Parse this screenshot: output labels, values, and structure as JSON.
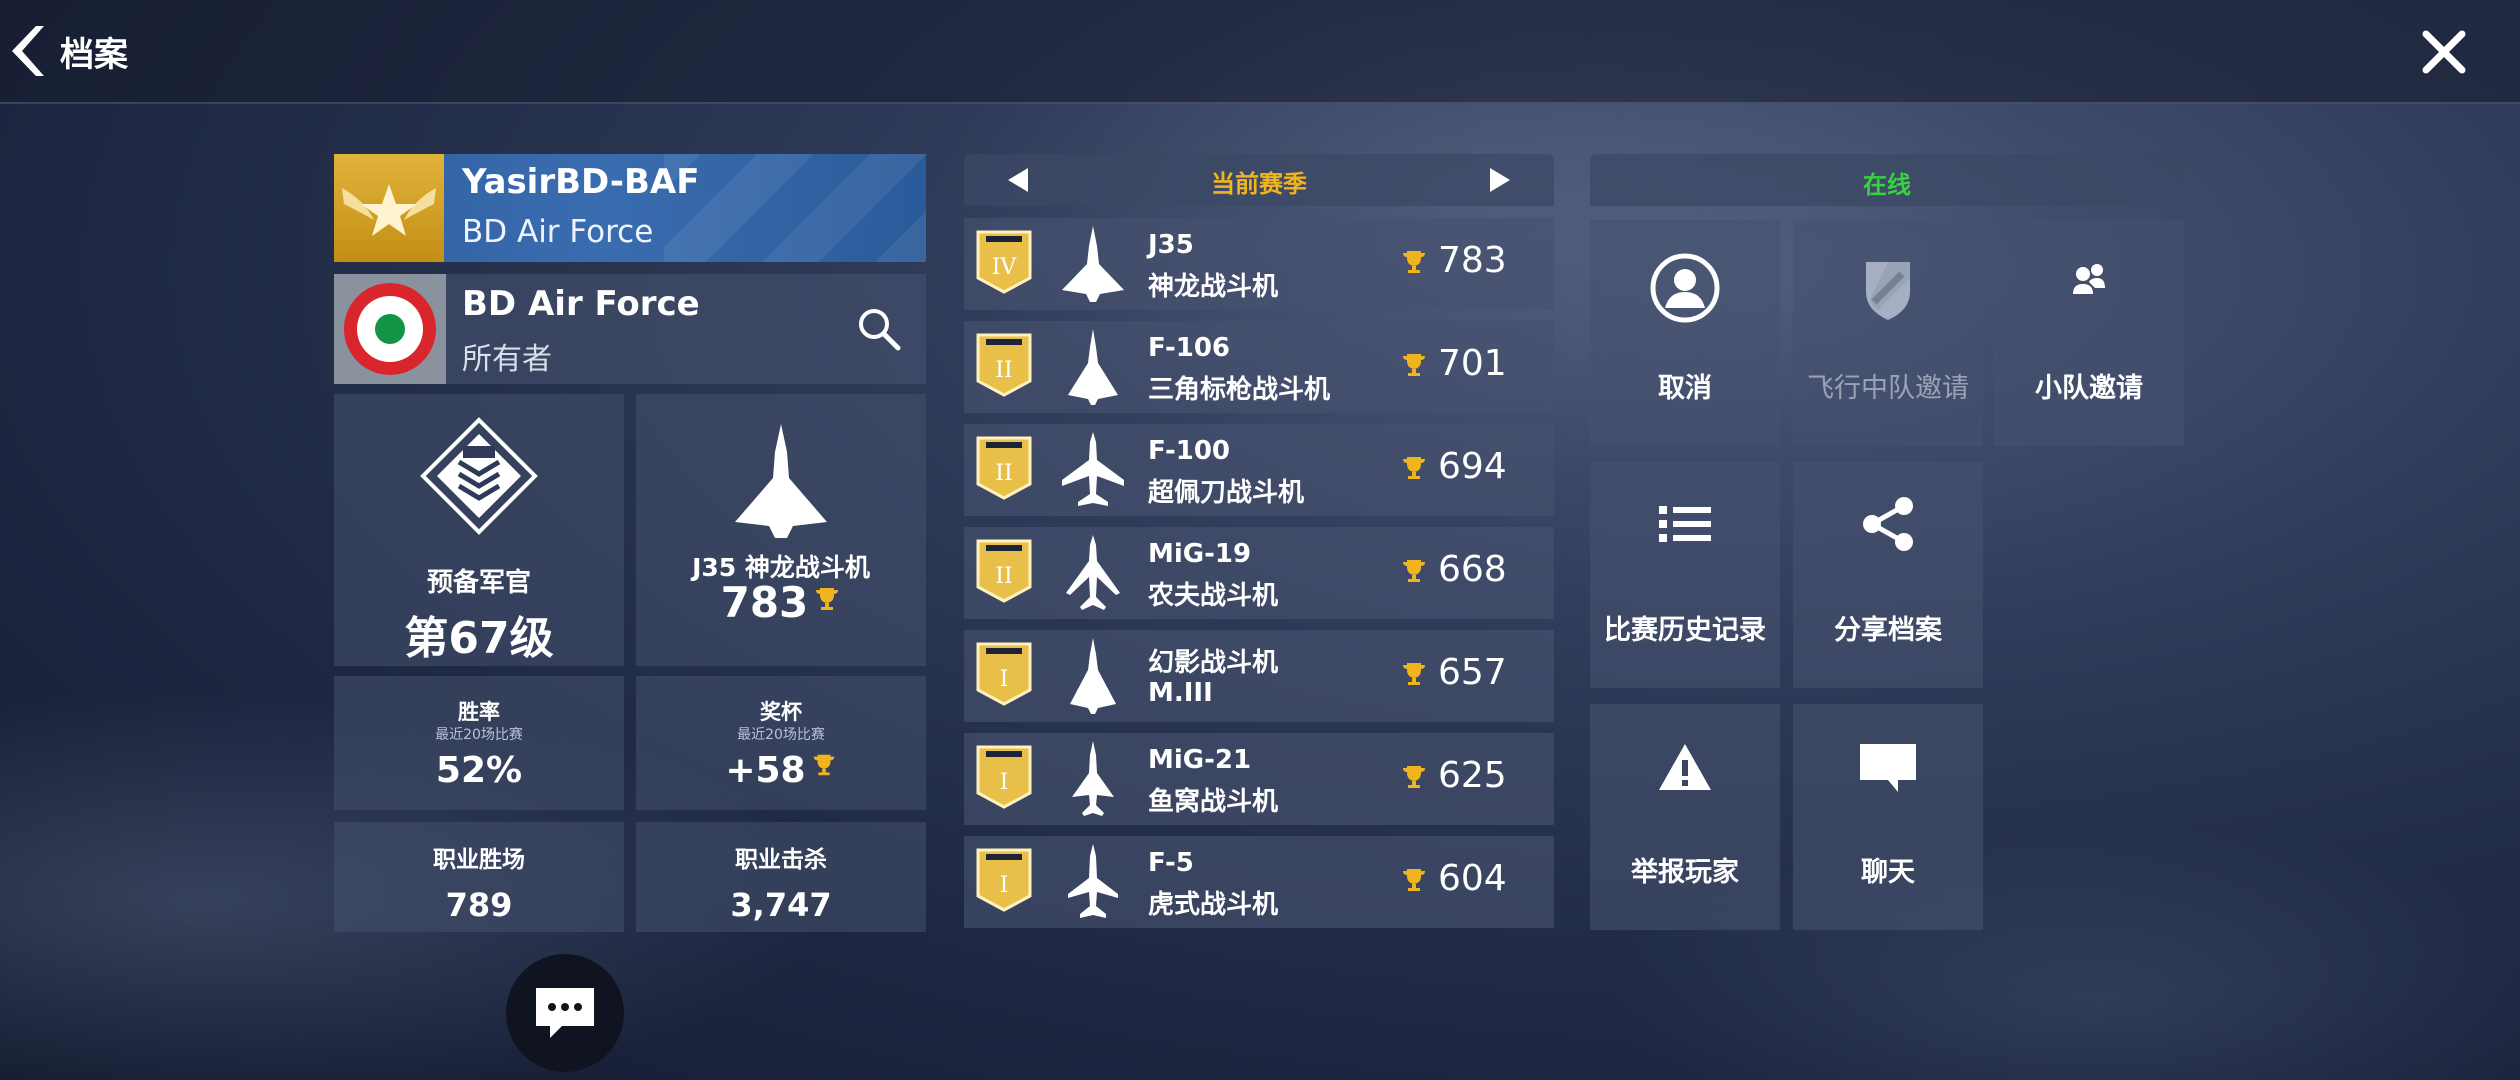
{
  "header": {
    "title": "档案"
  },
  "player": {
    "name": "YasirBD-BAF",
    "squadron": "BD Air Force"
  },
  "squad": {
    "name": "BD Air Force",
    "role": "所有者"
  },
  "rank": {
    "title": "预备军官",
    "level": "第67级"
  },
  "best_plane": {
    "name": "J35 神龙战斗机",
    "trophies": "783"
  },
  "stats": {
    "win_rate": {
      "title": "胜率",
      "sub": "最近20场比赛",
      "value": "52%"
    },
    "trophies": {
      "title": "奖杯",
      "sub": "最近20场比赛",
      "value": "+58"
    },
    "career_wins": {
      "title": "职业胜场",
      "value": "789"
    },
    "career_kills": {
      "title": "职业击杀",
      "value": "3,747"
    }
  },
  "season": {
    "title": "当前赛季"
  },
  "planes": [
    {
      "tier": "IV",
      "name": "J35",
      "subname": "神龙战斗机",
      "trophies": "783",
      "icon": "delta-jet-icon"
    },
    {
      "tier": "II",
      "name": "F-106",
      "subname": "三角标枪战斗机",
      "trophies": "701",
      "icon": "delta-jet-icon"
    },
    {
      "tier": "II",
      "name": "F-100",
      "subname": "超佩刀战斗机",
      "trophies": "694",
      "icon": "swept-jet-icon"
    },
    {
      "tier": "II",
      "name": "MiG-19",
      "subname": "农夫战斗机",
      "trophies": "668",
      "icon": "swept-jet-icon"
    },
    {
      "tier": "I",
      "name": "幻影战斗机",
      "subname": "M.III",
      "trophies": "657",
      "icon": "delta-jet-icon"
    },
    {
      "tier": "I",
      "name": "MiG-21",
      "subname": "鱼窝战斗机",
      "trophies": "625",
      "icon": "delta-jet-icon"
    },
    {
      "tier": "I",
      "name": "F-5",
      "subname": "虎式战斗机",
      "trophies": "604",
      "icon": "fighter-jet-icon"
    }
  ],
  "online": {
    "status": "在线"
  },
  "actions": {
    "cancel": "取消",
    "squad_invite": "飞行中队邀请",
    "team_invite": "小队邀请",
    "match_history": "比赛历史记录",
    "share_profile": "分享档案",
    "report": "举报玩家",
    "chat": "聊天"
  },
  "colors": {
    "gold": "#f0b41e",
    "online_green": "#37d23f",
    "banner_blue": "#3a6db0"
  }
}
